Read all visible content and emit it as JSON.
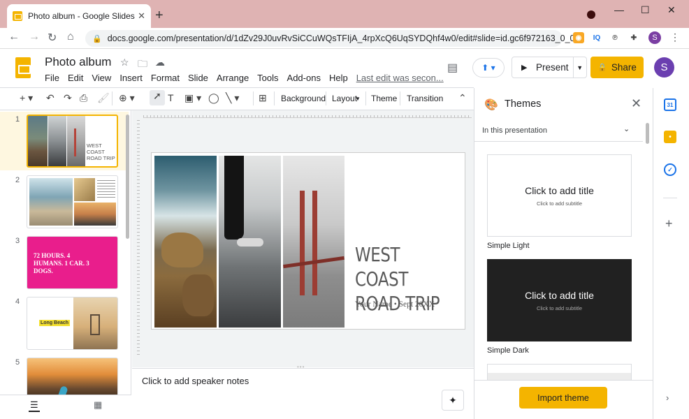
{
  "browser": {
    "tab_title": "Photo album - Google Slides",
    "url": "docs.google.com/presentation/d/1dZv29J0uvRvSiCCuWQsTFIjA_4rpXcQ6UqSYDQhf4w0/edit#slide=id.gc6f972163_0_0",
    "profile_initial": "S"
  },
  "app": {
    "doc_title": "Photo album",
    "menu": [
      "File",
      "Edit",
      "View",
      "Insert",
      "Format",
      "Slide",
      "Arrange",
      "Tools",
      "Add-ons",
      "Help"
    ],
    "last_edit": "Last edit was secon...",
    "present_label": "Present",
    "share_label": "Share",
    "avatar_initial": "S"
  },
  "toolbar": {
    "background": "Background",
    "layout": "Layout",
    "theme": "Theme",
    "transition": "Transition"
  },
  "filmstrip": {
    "slides": [
      {
        "num": "1",
        "title": "WEST COAST ROAD TRIP"
      },
      {
        "num": "2"
      },
      {
        "num": "3",
        "text": "72 HOURS. 4 HUMANS. 1 CAR. 3 DOGS."
      },
      {
        "num": "4",
        "label": "Long Beach"
      },
      {
        "num": "5"
      }
    ]
  },
  "slide": {
    "title_line1": "WEST COAST",
    "title_line2": "ROAD TRIP",
    "subtitle": "Your Name • Sept 20XX"
  },
  "notes_placeholder": "Click to add speaker notes",
  "themes": {
    "title": "Themes",
    "section": "In this presentation",
    "cards": [
      {
        "name": "Simple Light",
        "title": "Click to add title",
        "subtitle": "Click to add subtitle"
      },
      {
        "name": "Simple Dark",
        "title": "Click to add title",
        "subtitle": "Click to add subtitle"
      }
    ],
    "import_label": "Import theme"
  },
  "colors": {
    "accent": "#f4b400",
    "pink": "#e91e8c"
  }
}
